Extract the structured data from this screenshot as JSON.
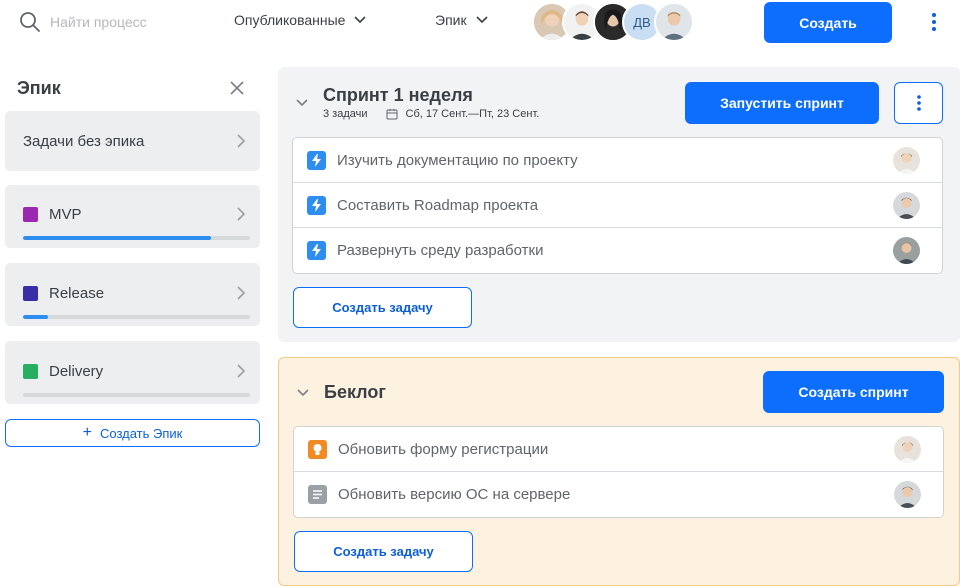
{
  "topbar": {
    "search_placeholder": "Найти процесс",
    "filter_published": "Опубликованные",
    "filter_epic": "Эпик",
    "team_initials": "ДВ",
    "create_label": "Создать"
  },
  "sidebar": {
    "title": "Эпик",
    "no_epic_label": "Задачи без эпика",
    "epics": [
      {
        "label": "MVP",
        "color": "#9c27b0",
        "progress": 0.83
      },
      {
        "label": "Release",
        "color": "#3a2ea8",
        "progress": 0.11
      },
      {
        "label": "Delivery",
        "color": "#27ae60",
        "progress": 0.0
      }
    ],
    "create_epic_label": "Создать Эпик"
  },
  "sprint": {
    "title": "Спринт 1 неделя",
    "task_count": "3 задачи",
    "dates": "Сб, 17 Сент.—Пт, 23 Сент.",
    "start_label": "Запустить спринт",
    "tasks": [
      {
        "title": "Изучить документацию по проекту",
        "icon": "lightning-icon",
        "icon_color": "#2d8ef0"
      },
      {
        "title": "Составить Roadmap проекта",
        "icon": "lightning-icon",
        "icon_color": "#2d8ef0"
      },
      {
        "title": "Развернуть среду разработки",
        "icon": "lightning-icon",
        "icon_color": "#2d8ef0"
      }
    ],
    "create_task_label": "Создать задачу"
  },
  "backlog": {
    "title": "Беклог",
    "create_sprint_label": "Создать спринт",
    "tasks": [
      {
        "title": "Обновить форму регистрации",
        "icon": "lightbulb-icon",
        "icon_color": "#f08a24"
      },
      {
        "title": "Обновить версию ОС на сервере",
        "icon": "document-icon",
        "icon_color": "#9aa0a6"
      }
    ],
    "create_task_label": "Создать задачу"
  }
}
